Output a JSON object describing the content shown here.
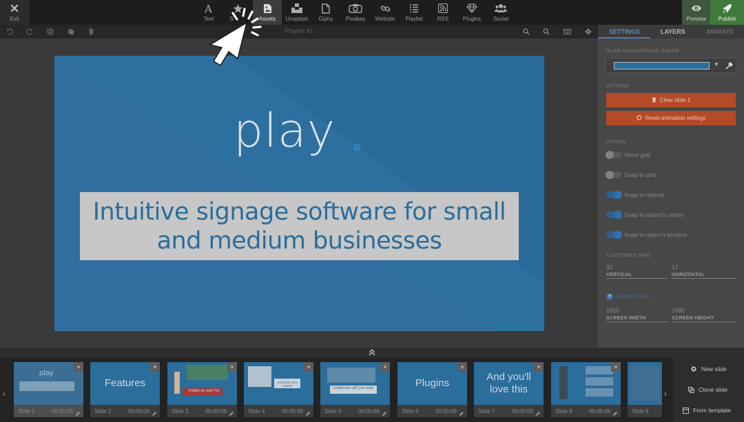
{
  "toolbar": {
    "exit": "Exit",
    "items": [
      {
        "label": "Text",
        "icon": "text-icon"
      },
      {
        "label": "Shapes",
        "icon": "star-icon"
      },
      {
        "label": "Assets",
        "icon": "assets-icon"
      },
      {
        "label": "Unsplash",
        "icon": "unsplash-icon"
      },
      {
        "label": "Giphy",
        "icon": "giphy-icon"
      },
      {
        "label": "Pixabay",
        "icon": "camera-icon"
      },
      {
        "label": "Website",
        "icon": "link-icon"
      },
      {
        "label": "Playlist",
        "icon": "list-icon"
      },
      {
        "label": "RSS",
        "icon": "rss-icon"
      },
      {
        "label": "Plugins",
        "icon": "diamond-icon"
      },
      {
        "label": "Social",
        "icon": "users-icon"
      }
    ],
    "shapes_partial": "S",
    "preview": "Preview",
    "publish": "Publish"
  },
  "subbar": {
    "title": "Playlist #1"
  },
  "slide": {
    "logo": "play",
    "caption": "Intuitive signage software for small and medium businesses",
    "background": "#2d6f9e"
  },
  "panel": {
    "tabs": {
      "settings": "SETTINGS",
      "layers": "LAYERS",
      "animate": "ANIMATE"
    },
    "bg_color_label": "SLIDE BACKGROUND COLOR",
    "bg_color": "#2b6d9b",
    "actions_label": "ACTIONS",
    "clear_slide": "Clear slide 1",
    "reset_animation": "Reset animation settings",
    "guides_label": "GUIDES",
    "guides": [
      {
        "label": "Show grid",
        "on": false
      },
      {
        "label": "Snap to grid",
        "on": false
      },
      {
        "label": "Snap to objects",
        "on": true
      },
      {
        "label": "Snap to object's center",
        "on": true
      },
      {
        "label": "Snap to object's borders",
        "on": true
      }
    ],
    "grid_label": "CUSTOMIZE GRID",
    "grid": {
      "vertical_value": "31",
      "vertical_label": "VERTICAL",
      "horizontal_value": "17",
      "horizontal_label": "HORIZONTAL"
    },
    "screen_size_label": "SCREEN SIZE",
    "screen": {
      "width_value": "1920",
      "width_label": "SCREEN WIDTH",
      "height_value": "1080",
      "height_label": "SCREEN HEIGHT"
    }
  },
  "filmstrip": {
    "slides": [
      {
        "name": "Slide 1",
        "time": "00:00:05",
        "text": "play"
      },
      {
        "name": "Slide 2",
        "time": "00:00:06",
        "text": "Features"
      },
      {
        "name": "Slide 3",
        "time": "00:00:06",
        "text": "Publish on your TVs"
      },
      {
        "name": "Slide 4",
        "time": "00:00:06",
        "text": "Schedule your content"
      },
      {
        "name": "Slide 5",
        "time": "00:00:06",
        "text": "Collaborate with your team"
      },
      {
        "name": "Slide 6",
        "time": "00:00:06",
        "text": "Plugins"
      },
      {
        "name": "Slide 7",
        "time": "00:00:06",
        "text": "And you'll love this"
      },
      {
        "name": "Slide 8",
        "time": "00:00:06",
        "text": ""
      },
      {
        "name": "Slide 9",
        "time": "",
        "text": ""
      }
    ],
    "new_slide": "New slide",
    "clone_slide": "Clone slide",
    "from_template": "From template"
  }
}
